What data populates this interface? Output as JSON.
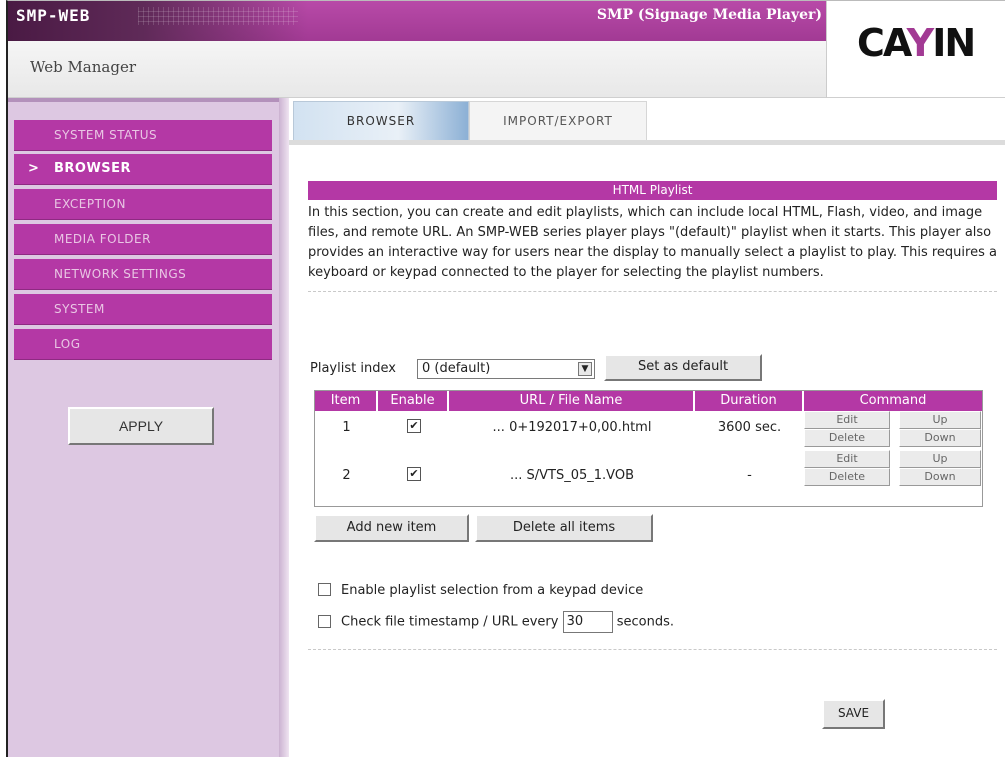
{
  "header": {
    "brand": "SMP-WEB",
    "app_title": "SMP (Signage Media Player)",
    "subtitle": "Web Manager",
    "logo_text": "CAYIN"
  },
  "sidebar": {
    "items": [
      {
        "label": "SYSTEM STATUS",
        "active": false
      },
      {
        "label": "BROWSER",
        "active": true
      },
      {
        "label": "EXCEPTION",
        "active": false
      },
      {
        "label": "MEDIA FOLDER",
        "active": false
      },
      {
        "label": "NETWORK SETTINGS",
        "active": false
      },
      {
        "label": "SYSTEM",
        "active": false
      },
      {
        "label": "LOG",
        "active": false
      }
    ],
    "apply_label": "APPLY"
  },
  "tabs": [
    {
      "label": "BROWSER",
      "active": true
    },
    {
      "label": "IMPORT/EXPORT",
      "active": false
    }
  ],
  "main": {
    "section_title": "HTML Playlist",
    "description": "In this section, you can create and edit playlists, which can include local HTML, Flash, video, and image files, and remote URL. An SMP-WEB series player plays \"(default)\" playlist when it starts. This player also provides an interactive way for users near the display to manually select a playlist to play. This requires a keyboard or keypad connected to the player for selecting the playlist numbers.",
    "index_label": "Playlist index",
    "index_value": "0 (default)",
    "set_default_label": "Set as default",
    "table": {
      "headers": [
        "Item",
        "Enable",
        "URL / File Name",
        "Duration",
        "Command"
      ],
      "rows": [
        {
          "item": "1",
          "enabled": "✔",
          "file": "... 0+192017+0,00.html",
          "duration": "3600 sec."
        },
        {
          "item": "2",
          "enabled": "✔",
          "file": "... S/VTS_05_1.VOB",
          "duration": "-"
        }
      ],
      "cmd": {
        "edit": "Edit",
        "up": "Up",
        "delete": "Delete",
        "down": "Down"
      }
    },
    "add_label": "Add new item",
    "delete_all_label": "Delete all items",
    "keypad_option": "Enable playlist selection from a keypad device",
    "timestamp_prefix": "Check file timestamp / URL every",
    "timestamp_value": "30",
    "timestamp_suffix": "seconds.",
    "save_label": "SAVE"
  },
  "colors": {
    "accent": "#b438a5",
    "sidebar_bg": "#ddc8e2"
  }
}
